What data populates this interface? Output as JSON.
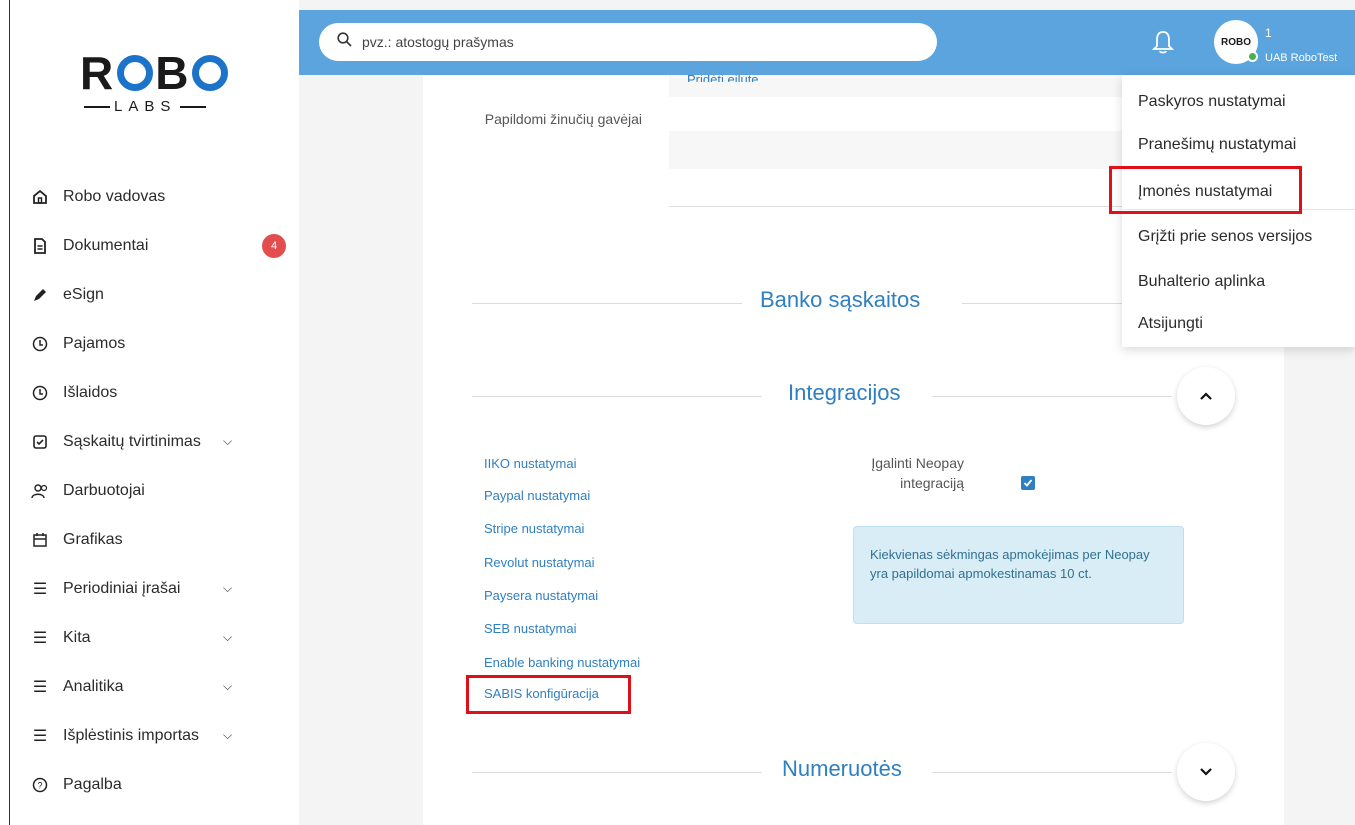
{
  "sidebar": {
    "logo": {
      "text": "ROBO",
      "sub": "LABS"
    },
    "items": [
      {
        "label": "Robo vadovas",
        "icon": "home-icon"
      },
      {
        "label": "Dokumentai",
        "icon": "document-icon",
        "badge": "4"
      },
      {
        "label": "eSign",
        "icon": "pen-icon"
      },
      {
        "label": "Pajamos",
        "icon": "income-icon"
      },
      {
        "label": "Išlaidos",
        "icon": "expenses-icon"
      },
      {
        "label": "Sąskaitų tvirtinimas",
        "icon": "invoice-check-icon",
        "expandable": true
      },
      {
        "label": "Darbuotojai",
        "icon": "users-icon"
      },
      {
        "label": "Grafikas",
        "icon": "calendar-icon"
      },
      {
        "label": "Periodiniai įrašai",
        "icon": "list-icon",
        "expandable": true
      },
      {
        "label": "Kita",
        "icon": "list-icon",
        "expandable": true
      },
      {
        "label": "Analitika",
        "icon": "list-icon",
        "expandable": true
      },
      {
        "label": "Išplėstinis importas",
        "icon": "list-icon",
        "expandable": true
      },
      {
        "label": "Pagalba",
        "icon": "help-icon"
      }
    ]
  },
  "topbar": {
    "search_placeholder": "pvz.: atostogų prašymas",
    "user_number": "1",
    "user_company": "UAB RoboTest",
    "avatar_text": "ROBO"
  },
  "content": {
    "add_row_link": "Pridėti eilutę",
    "additional_recipients_label": "Papildomi žinučių gavėjai",
    "section_bank": "Banko sąskaitos",
    "section_integrations": "Integracijos",
    "section_numbering": "Numeruotės",
    "integration_links": [
      "IIKO nustatymai",
      "Paypal nustatymai",
      "Stripe nustatymai",
      "Revolut nustatymai",
      "Paysera nustatymai",
      "SEB nustatymai",
      "Enable banking nustatymai",
      "SABIS konfigūracija"
    ],
    "neopay_label": "Įgalinti Neopay integraciją",
    "neopay_checked": true,
    "neopay_info": "Kiekvienas sėkmingas apmokėjimas per Neopay yra papildomai apmokestinamas 10 ct."
  },
  "user_menu": {
    "items": [
      "Paskyros nustatymai",
      "Pranešimų nustatymai",
      "Įmonės nustatymai",
      "Grįžti prie senos versijos",
      "Buhalterio aplinka",
      "Atsijungti"
    ]
  },
  "colors": {
    "topbar": "#5ba4dd",
    "accent": "#2f7fc1",
    "highlight": "#e0101b",
    "badge": "#e44d4d"
  }
}
